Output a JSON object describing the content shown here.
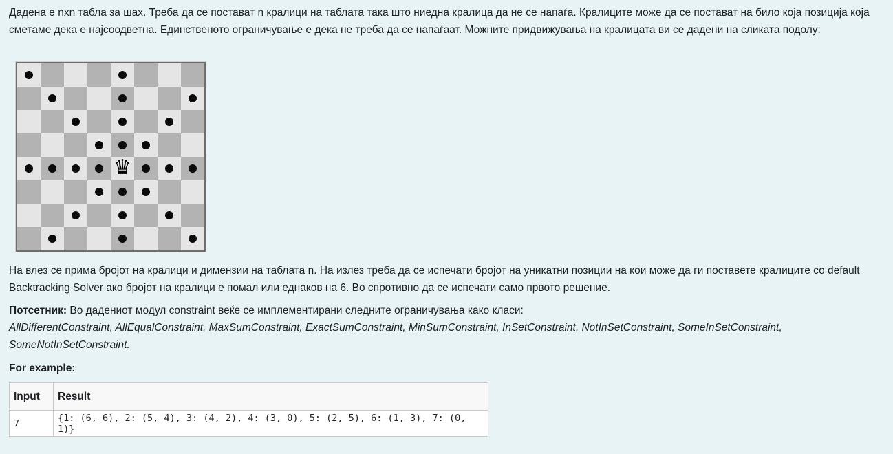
{
  "intro": "Дадена е nxn табла за шах. Треба да се постават n кралици на таблата така што ниедна кралица да не се напаѓа. Кралиците може да се постават на било која позиција која сметаме дека е најсоодветна. Единственото ограничување е дека не треба да се напаѓаат. Можните придвижувања на кралицата ви се дадени на сликата подолу:",
  "board": {
    "size": 8,
    "queen": [
      4,
      4
    ],
    "dots": [
      [
        0,
        0
      ],
      [
        0,
        4
      ],
      [
        1,
        1
      ],
      [
        1,
        4
      ],
      [
        1,
        7
      ],
      [
        2,
        2
      ],
      [
        2,
        4
      ],
      [
        2,
        6
      ],
      [
        3,
        3
      ],
      [
        3,
        4
      ],
      [
        3,
        5
      ],
      [
        4,
        0
      ],
      [
        4,
        1
      ],
      [
        4,
        2
      ],
      [
        4,
        3
      ],
      [
        4,
        5
      ],
      [
        4,
        6
      ],
      [
        4,
        7
      ],
      [
        5,
        3
      ],
      [
        5,
        4
      ],
      [
        5,
        5
      ],
      [
        6,
        2
      ],
      [
        6,
        4
      ],
      [
        6,
        6
      ],
      [
        7,
        1
      ],
      [
        7,
        4
      ],
      [
        7,
        7
      ]
    ]
  },
  "description": "На влез се прима бројот на кралици и димензии на таблата n. На излез треба да се испечати бројот на уникатни позиции на кои може да ги поставете кралиците со default Backtracking Solver ако бројот на кралици е помал или еднаков на 6. Во спротивно да се испечати само првото решение.",
  "hint": {
    "label": "Потсетник:",
    "text": " Во дадениот модул constraint веќе се имплементирани следните ограничувања како класи:",
    "classes": "AllDifferentConstraint, AllEqualConstraint, MaxSumConstraint, ExactSumConstraint,  MinSumConstraint, InSetConstraint, NotInSetConstraint, SomeInSetConstraint, SomeNotInSetConstraint."
  },
  "example_label": "For example:",
  "table": {
    "headers": {
      "input": "Input",
      "result": "Result"
    },
    "rows": [
      {
        "input": "7",
        "result": "{1: (6, 6), 2: (5, 4), 3: (4, 2), 4: (3, 0), 5: (2, 5), 6: (1, 3), 7: (0, 1)}"
      }
    ]
  }
}
